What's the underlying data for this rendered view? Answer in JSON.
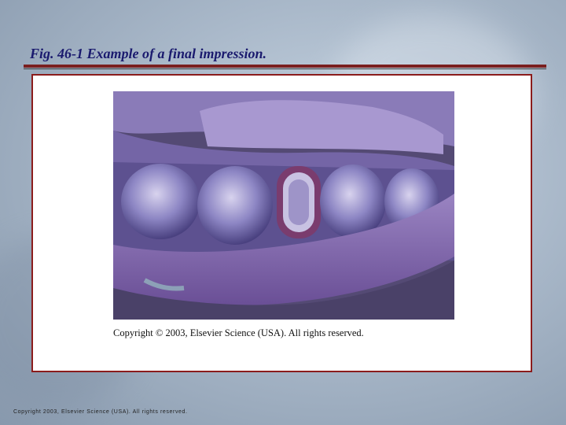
{
  "slide": {
    "title": "Fig. 46-1  Example of a final impression.",
    "caption": "Copyright © 2003, Elsevier Science (USA).  All rights reserved.",
    "footer": "Copyright 2003, Elsevier Science (USA). All rights reserved."
  },
  "colors": {
    "title": "#1a1a6e",
    "rule": "#7a1f1f",
    "frame_border": "#8b1c1c",
    "impression": "#7c6aa8"
  }
}
